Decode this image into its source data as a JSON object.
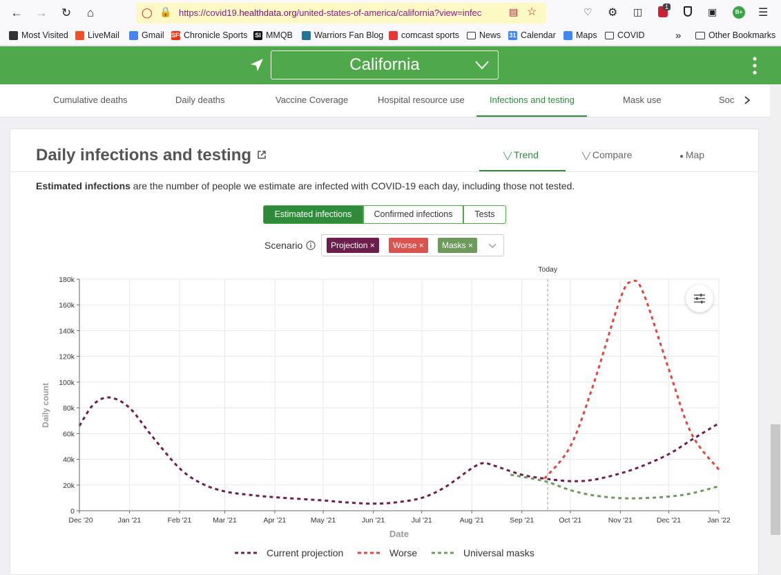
{
  "browser": {
    "url_prefix": "https://covid19.",
    "url_domain": "healthdata.org",
    "url_suffix": "/united-states-of-america/california?view=infec",
    "extension_badge": "1",
    "profile_initials": "B+"
  },
  "bookmarks": [
    {
      "label": "Most Visited",
      "icon": "gear-icon"
    },
    {
      "label": "LiveMail",
      "icon": "windows-icon"
    },
    {
      "label": "Gmail",
      "icon": "google-icon"
    },
    {
      "label": "Chronicle Sports",
      "icon": "sfg-icon",
      "icon_text": "SFG"
    },
    {
      "label": "MMQB",
      "icon": "si-icon",
      "icon_text": "SI"
    },
    {
      "label": "Warriors Fan Blog",
      "icon": "wordpress-icon"
    },
    {
      "label": "comcast sports",
      "icon": "nbc-icon"
    },
    {
      "label": "News",
      "icon": "folder-icon"
    },
    {
      "label": "Calendar",
      "icon": "calendar-icon",
      "icon_text": "31"
    },
    {
      "label": "Maps",
      "icon": "google-icon"
    },
    {
      "label": "COVID",
      "icon": "folder-icon"
    }
  ],
  "other_bookmarks": "Other Bookmarks",
  "header": {
    "location": "California"
  },
  "nav_tabs": [
    {
      "label": "Cumulative deaths",
      "active": false
    },
    {
      "label": "Daily deaths",
      "active": false
    },
    {
      "label": "Vaccine Coverage",
      "active": false
    },
    {
      "label": "Hospital resource use",
      "active": false
    },
    {
      "label": "Infections and testing",
      "active": true
    },
    {
      "label": "Mask use",
      "active": false
    },
    {
      "label": "Soc",
      "active": false
    }
  ],
  "card": {
    "title": "Daily infections and testing",
    "view_tabs": [
      {
        "label": "Trend",
        "active": true
      },
      {
        "label": "Compare",
        "active": false
      },
      {
        "label": "Map",
        "active": false
      }
    ],
    "description_bold": "Estimated infections",
    "description_rest": " are the number of people we estimate are infected with COVID-19 each day, including those not tested.",
    "segments": [
      {
        "label": "Estimated infections",
        "active": true
      },
      {
        "label": "Confirmed infections",
        "active": false
      },
      {
        "label": "Tests",
        "active": false
      }
    ],
    "scenario_label": "Scenario",
    "scenario_chips": [
      {
        "label": "Projection",
        "color": "#6b1f4a"
      },
      {
        "label": "Worse",
        "color": "#d9534f"
      },
      {
        "label": "Masks",
        "color": "#6e9a5c"
      }
    ]
  },
  "colors": {
    "brand_green": "#4fa84a",
    "active_tab": "#2e8b3a",
    "projection": "#6b1f4a",
    "worse": "#e0463f",
    "masks": "#6e9a5c"
  },
  "chart_data": {
    "type": "line",
    "xlabel": "Date",
    "ylabel": "Daily count",
    "x_ticks": [
      "Dec '20",
      "Jan '21",
      "Feb '21",
      "Mar '21",
      "Apr '21",
      "May '21",
      "Jun '21",
      "Jul '21",
      "Aug '21",
      "Sep '21",
      "Oct '21",
      "Nov '21",
      "Dec '21",
      "Jan '22"
    ],
    "y_ticks": [
      "0",
      "20k",
      "40k",
      "60k",
      "80k",
      "100k",
      "120k",
      "140k",
      "160k",
      "180k"
    ],
    "ylim": [
      0,
      180000
    ],
    "xlim": [
      "2020-12-01",
      "2022-01-01"
    ],
    "today_label": "Today",
    "today_date": "2021-09-17",
    "grid": true,
    "legend_position": "bottom",
    "series": [
      {
        "name": "Current projection",
        "color": "#6b1f4a",
        "points": [
          [
            "2020-12-01",
            66000
          ],
          [
            "2020-12-10",
            83000
          ],
          [
            "2020-12-20",
            88000
          ],
          [
            "2021-01-01",
            80000
          ],
          [
            "2021-01-15",
            58000
          ],
          [
            "2021-02-01",
            33000
          ],
          [
            "2021-02-15",
            21000
          ],
          [
            "2021-03-01",
            15000
          ],
          [
            "2021-03-15",
            12500
          ],
          [
            "2021-04-01",
            10500
          ],
          [
            "2021-05-01",
            8000
          ],
          [
            "2021-05-15",
            6500
          ],
          [
            "2021-06-01",
            5500
          ],
          [
            "2021-06-15",
            6500
          ],
          [
            "2021-07-01",
            10000
          ],
          [
            "2021-07-15",
            18000
          ],
          [
            "2021-08-01",
            33000
          ],
          [
            "2021-08-08",
            37000
          ],
          [
            "2021-08-15",
            35000
          ],
          [
            "2021-09-01",
            28000
          ],
          [
            "2021-09-15",
            25000
          ],
          [
            "2021-10-01",
            23000
          ],
          [
            "2021-10-15",
            24000
          ],
          [
            "2021-11-01",
            29000
          ],
          [
            "2021-11-15",
            35000
          ],
          [
            "2021-12-01",
            44000
          ],
          [
            "2021-12-15",
            55000
          ],
          [
            "2022-01-01",
            68000
          ]
        ]
      },
      {
        "name": "Worse",
        "color": "#e0463f",
        "points": [
          [
            "2021-09-15",
            25000
          ],
          [
            "2021-10-01",
            50000
          ],
          [
            "2021-10-15",
            97000
          ],
          [
            "2021-11-01",
            165000
          ],
          [
            "2021-11-08",
            178000
          ],
          [
            "2021-11-15",
            170000
          ],
          [
            "2021-12-01",
            110000
          ],
          [
            "2021-12-15",
            60000
          ],
          [
            "2022-01-01",
            32000
          ]
        ]
      },
      {
        "name": "Universal masks",
        "color": "#6e9a5c",
        "points": [
          [
            "2021-08-25",
            28000
          ],
          [
            "2021-09-15",
            23000
          ],
          [
            "2021-10-01",
            16000
          ],
          [
            "2021-10-15",
            12000
          ],
          [
            "2021-11-01",
            9800
          ],
          [
            "2021-11-15",
            9800
          ],
          [
            "2021-12-01",
            11000
          ],
          [
            "2021-12-15",
            13500
          ],
          [
            "2022-01-01",
            19000
          ]
        ]
      }
    ]
  }
}
